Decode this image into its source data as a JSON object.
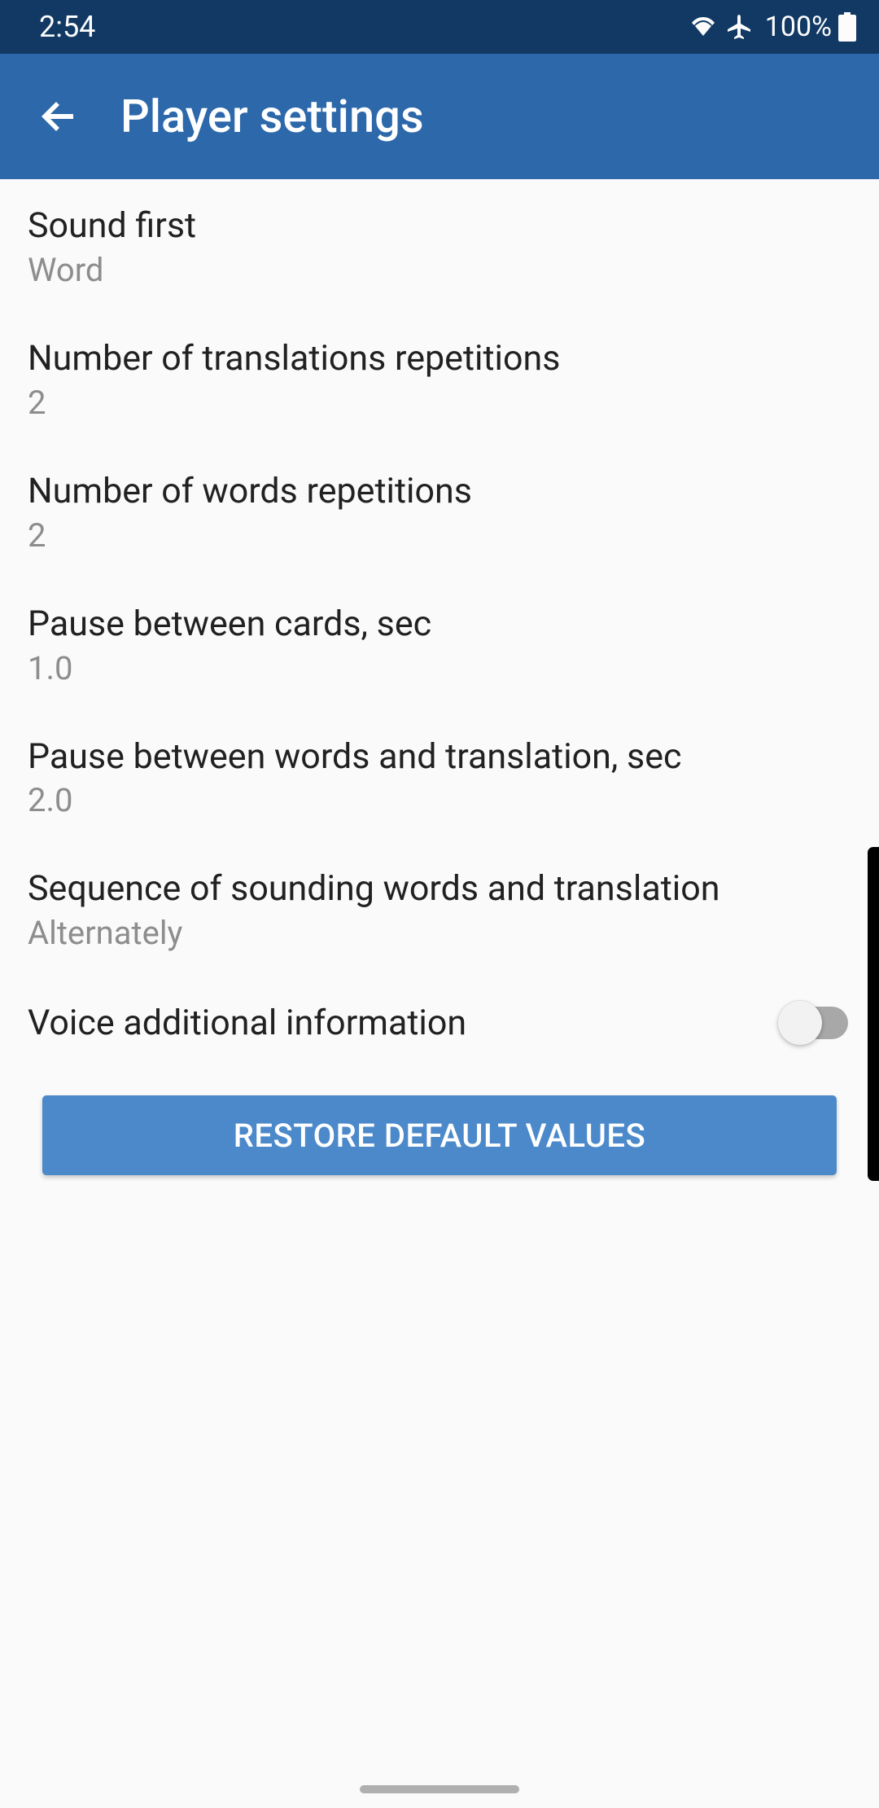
{
  "statusbar": {
    "time": "2:54",
    "battery": "100%"
  },
  "appbar": {
    "title": "Player settings"
  },
  "settings": {
    "sound_first": {
      "title": "Sound first",
      "value": "Word"
    },
    "trans_reps": {
      "title": "Number of translations repetitions",
      "value": "2"
    },
    "word_reps": {
      "title": "Number of words repetitions",
      "value": "2"
    },
    "pause_cards": {
      "title": "Pause between cards, sec",
      "value": "1.0"
    },
    "pause_word_trans": {
      "title": "Pause between words and translation, sec",
      "value": "2.0"
    },
    "sequence": {
      "title": "Sequence of sounding words and translation",
      "value": "Alternately"
    },
    "voice_additional": {
      "title": "Voice additional information",
      "enabled": false
    }
  },
  "restore_button": "RESTORE DEFAULT VALUES"
}
